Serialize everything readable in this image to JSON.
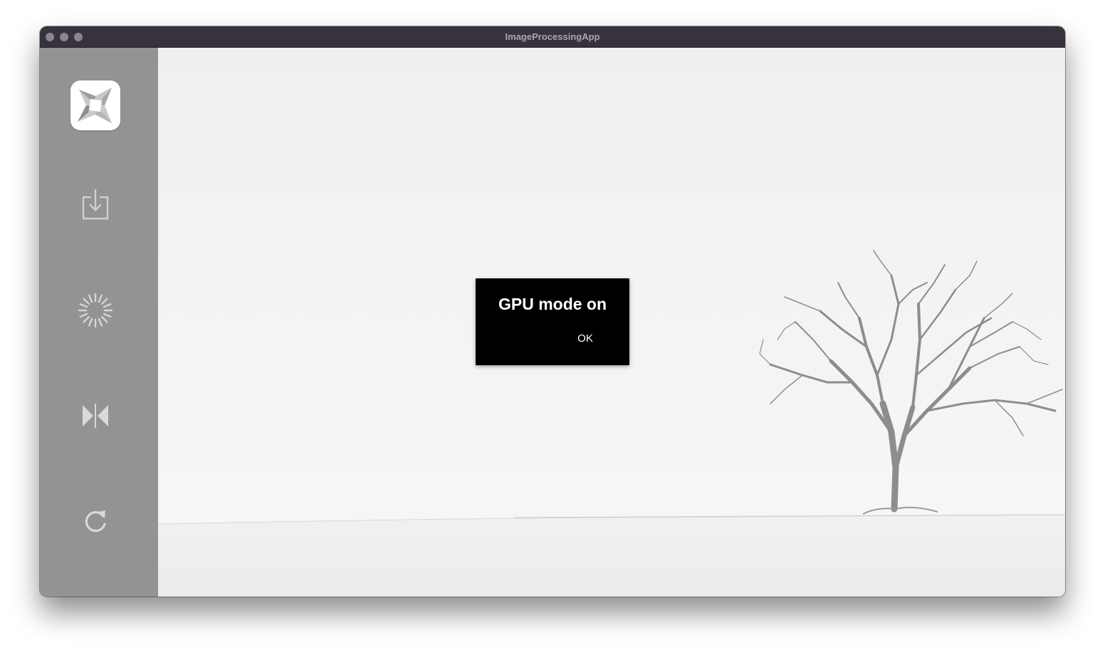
{
  "window": {
    "title": "ImageProcessingApp"
  },
  "sidebar": {
    "items": [
      {
        "name": "app-logo",
        "icon": "app-logo-icon"
      },
      {
        "name": "import-button",
        "icon": "download-tray-icon"
      },
      {
        "name": "gpu-mode-button",
        "icon": "spinner-icon"
      },
      {
        "name": "flip-button",
        "icon": "flip-horizontal-icon"
      },
      {
        "name": "reset-button",
        "icon": "refresh-icon"
      }
    ]
  },
  "toast": {
    "message": "GPU mode on",
    "ok_label": "OK"
  },
  "colors": {
    "titlebar": "#38323d",
    "sidebar": "#939393",
    "icon": "#cfcfcf",
    "toast_bg": "#000000",
    "toast_text": "#ffffff"
  }
}
